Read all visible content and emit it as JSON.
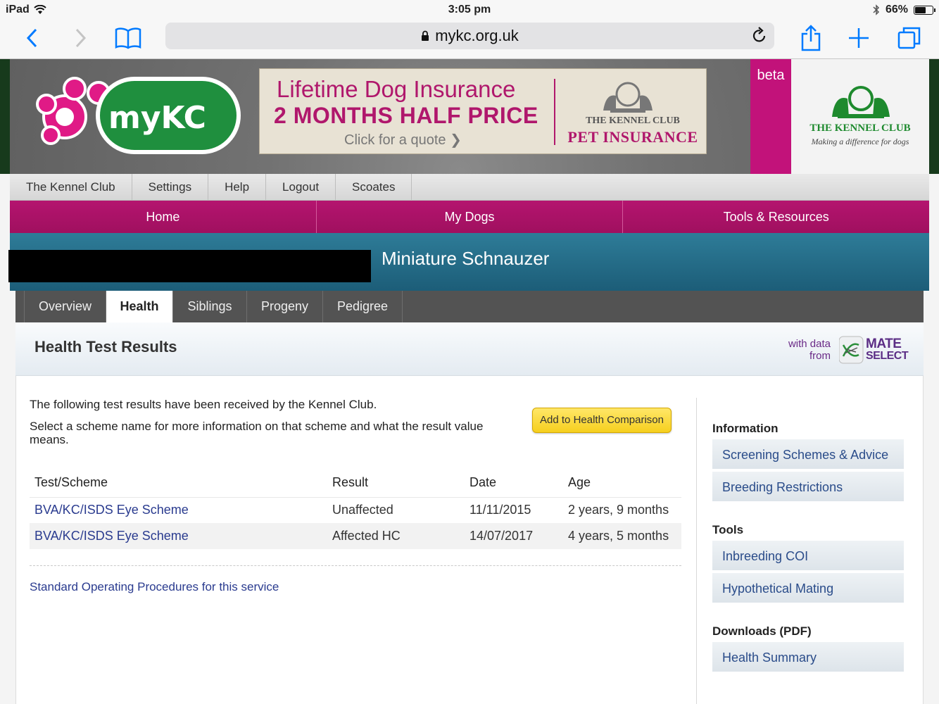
{
  "status": {
    "device": "iPad",
    "time": "3:05 pm",
    "battery": "66%",
    "battery_level": 0.66
  },
  "browser": {
    "url": "mykc.org.uk"
  },
  "banner": {
    "logo_text": "myKC",
    "ad": {
      "line1": "Lifetime Dog Insurance",
      "line2": "2 MONTHS HALF PRICE",
      "line3": "Click for a quote",
      "brand_top": "THE KENNEL CLUB",
      "brand_bottom": "PET INSURANCE"
    },
    "beta": "beta",
    "kc_title": "THE KENNEL CLUB",
    "kc_tagline": "Making a difference for dogs"
  },
  "topnav": [
    "The Kennel Club",
    "Settings",
    "Help",
    "Logout",
    "Scoates"
  ],
  "mainnav": [
    "Home",
    "My Dogs",
    "Tools & Resources"
  ],
  "dog": {
    "breed": "Miniature Schnauzer"
  },
  "tabs": [
    "Overview",
    "Health",
    "Siblings",
    "Progeny",
    "Pedigree"
  ],
  "health": {
    "title": "Health Test Results",
    "with_data": "with data",
    "from": "from",
    "mate": "MATE",
    "select": "SELECT",
    "intro1": "The following test results have been received by the Kennel Club.",
    "intro2": "Select a scheme name for more information on that scheme and what the result value means.",
    "add_button": "Add to Health Comparison",
    "columns": [
      "Test/Scheme",
      "Result",
      "Date",
      "Age"
    ],
    "rows": [
      {
        "scheme": "BVA/KC/ISDS Eye Scheme",
        "result": "Unaffected",
        "date": "11/11/2015",
        "age": "2 years, 9 months"
      },
      {
        "scheme": "BVA/KC/ISDS Eye Scheme",
        "result": "Affected HC",
        "date": "14/07/2017",
        "age": "4 years, 5 months"
      }
    ],
    "sop": "Standard Operating Procedures for this service"
  },
  "sidebar": {
    "information": {
      "heading": "Information",
      "items": [
        "Screening Schemes & Advice",
        "Breeding Restrictions"
      ]
    },
    "tools": {
      "heading": "Tools",
      "items": [
        "Inbreeding COI",
        "Hypothetical Mating"
      ]
    },
    "downloads": {
      "heading": "Downloads (PDF)",
      "items": [
        "Health Summary"
      ]
    }
  },
  "colors": {
    "accent": "#007aff",
    "magenta": "#b4146f",
    "teal": "#23688a",
    "link": "#2a3b8f"
  }
}
